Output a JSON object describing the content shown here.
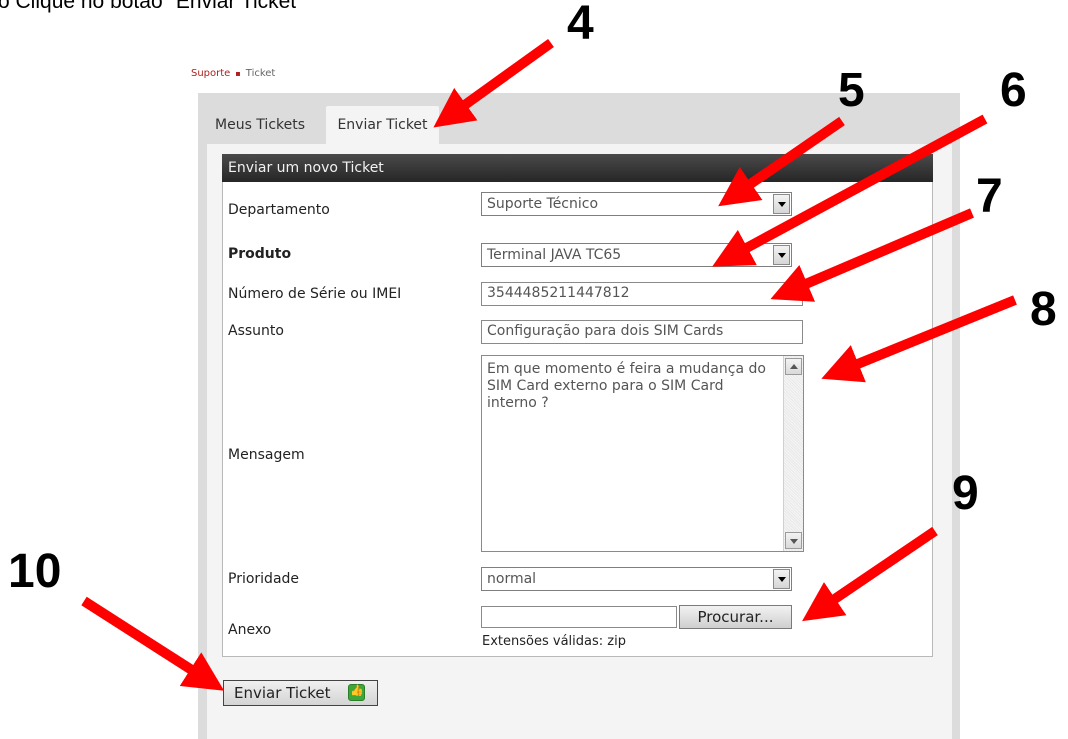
{
  "instruction": "o Clique no botão \"Enviar Ticket\"",
  "breadcrumb": {
    "link": "Suporte",
    "separator": "▪",
    "current": "Ticket"
  },
  "tabs": [
    {
      "label": "Meus Tickets"
    },
    {
      "label": "Enviar Ticket"
    }
  ],
  "form": {
    "title": "Enviar um novo Ticket",
    "department": {
      "label": "Departamento",
      "value": "Suporte Técnico"
    },
    "product": {
      "label": "Produto",
      "value": "Terminal JAVA TC65"
    },
    "serial": {
      "label": "Número de Série ou IMEI",
      "value": "3544485211447812"
    },
    "subject": {
      "label": "Assunto",
      "value": "Configuração para dois SIM Cards"
    },
    "message": {
      "label": "Mensagem",
      "value": "Em que momento é feira a mudança do SIM Card externo para o SIM Card interno ?"
    },
    "priority": {
      "label": "Prioridade",
      "value": "normal"
    },
    "attachment": {
      "label": "Anexo",
      "browse_label": "Procurar...",
      "hint": "Extensões válidas: zip"
    },
    "submit_label": "Enviar Ticket"
  },
  "step_markers": [
    "4",
    "5",
    "6",
    "7",
    "8",
    "9",
    "10"
  ],
  "colors": {
    "arrow": "#ff0000",
    "header_bg": "#333333",
    "link": "#b02020",
    "thumb": "#3fa63a"
  }
}
